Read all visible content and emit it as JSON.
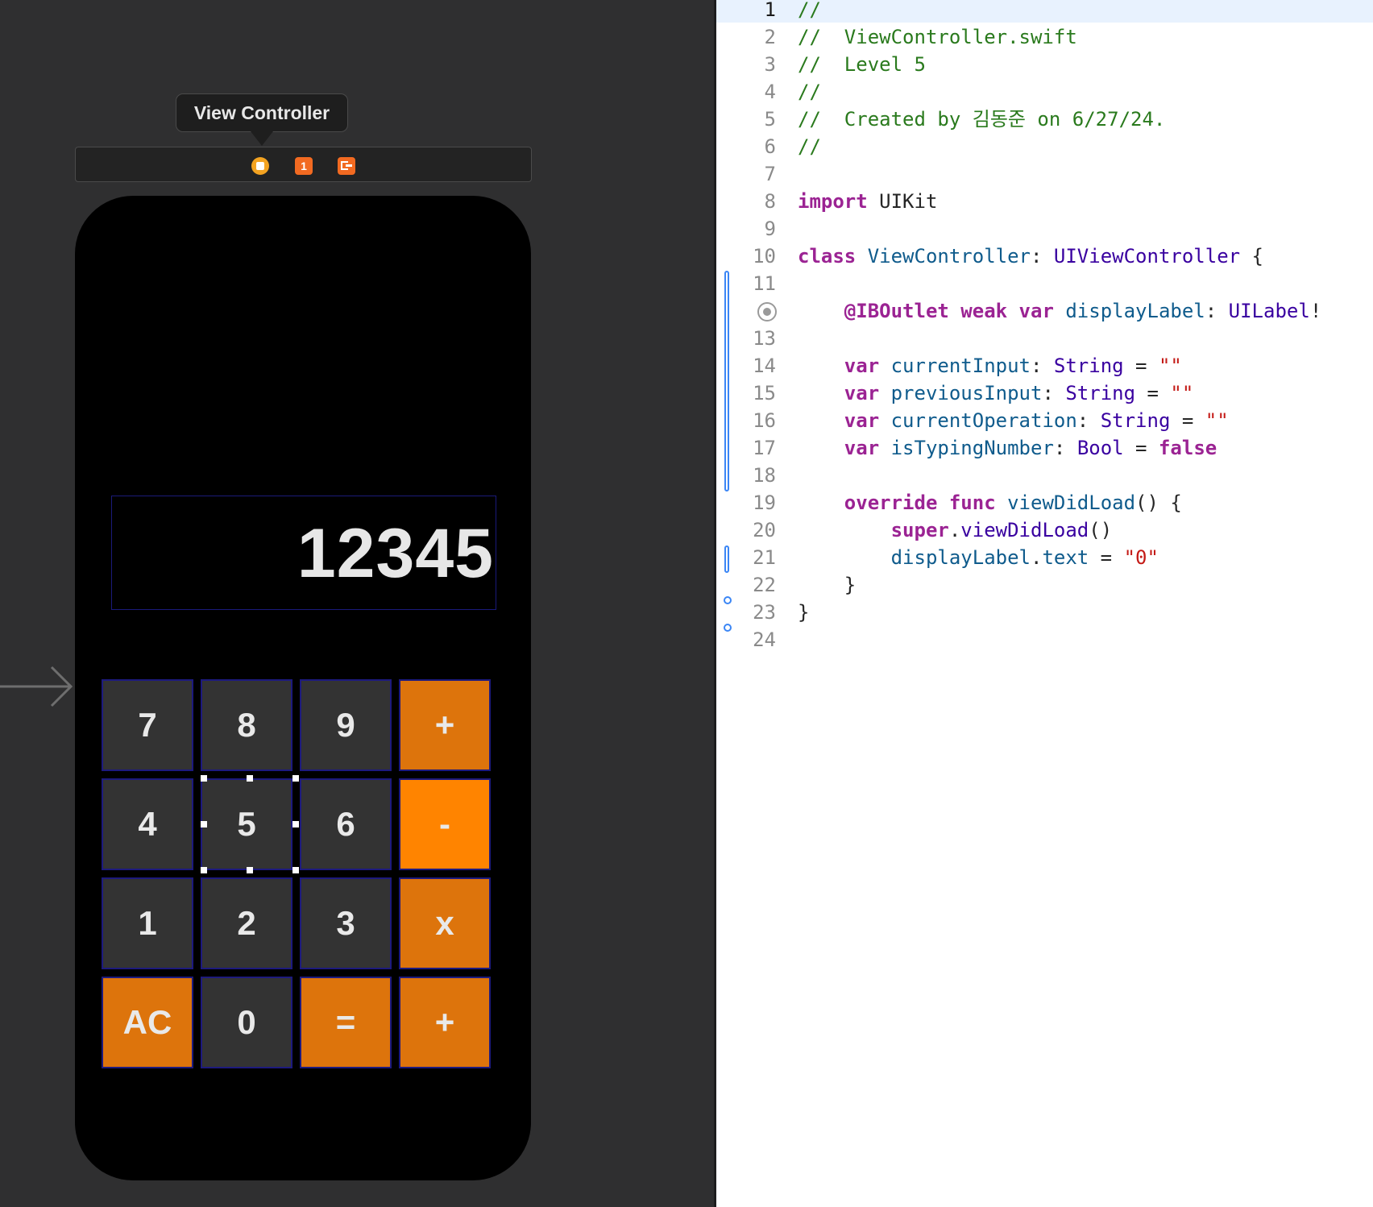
{
  "storyboard": {
    "scene_title": "View Controller",
    "dock": {
      "vc_icon": "view-controller-icon",
      "first_responder_label": "1",
      "exit_icon": "exit-icon"
    },
    "display_text": "12345",
    "keys": [
      "7",
      "8",
      "9",
      "+",
      "4",
      "5",
      "6",
      "-",
      "1",
      "2",
      "3",
      "x",
      "AC",
      "0",
      "=",
      "+"
    ],
    "colors": {
      "op_key": "#dd740c",
      "op_key_highlight": "#ff8400",
      "num_key": "#333333"
    }
  },
  "editor": {
    "current_line": 1,
    "lines": [
      {
        "n": "1",
        "tokens": [
          {
            "c": "c",
            "t": "//"
          }
        ]
      },
      {
        "n": "2",
        "tokens": [
          {
            "c": "c",
            "t": "//  ViewController.swift"
          }
        ]
      },
      {
        "n": "3",
        "tokens": [
          {
            "c": "c",
            "t": "//  Level 5"
          }
        ]
      },
      {
        "n": "4",
        "tokens": [
          {
            "c": "c",
            "t": "//"
          }
        ]
      },
      {
        "n": "5",
        "tokens": [
          {
            "c": "c",
            "t": "//  Created by 김동준 on 6/27/24."
          }
        ]
      },
      {
        "n": "6",
        "tokens": [
          {
            "c": "c",
            "t": "//"
          }
        ]
      },
      {
        "n": "7",
        "tokens": []
      },
      {
        "n": "8",
        "tokens": [
          {
            "c": "k",
            "t": "import"
          },
          {
            "c": "",
            "t": " UIKit"
          }
        ]
      },
      {
        "n": "9",
        "tokens": []
      },
      {
        "n": "10",
        "tokens": [
          {
            "c": "k",
            "t": "class"
          },
          {
            "c": "",
            "t": " "
          },
          {
            "c": "n",
            "t": "ViewController"
          },
          {
            "c": "",
            "t": ": "
          },
          {
            "c": "t",
            "t": "UIViewController"
          },
          {
            "c": "",
            "t": " {"
          }
        ]
      },
      {
        "n": "11",
        "tokens": []
      },
      {
        "n": "",
        "tokens": [
          {
            "c": "",
            "t": "    "
          },
          {
            "c": "k",
            "t": "@IBOutlet"
          },
          {
            "c": "",
            "t": " "
          },
          {
            "c": "k",
            "t": "weak"
          },
          {
            "c": "",
            "t": " "
          },
          {
            "c": "k",
            "t": "var"
          },
          {
            "c": "",
            "t": " "
          },
          {
            "c": "n",
            "t": "displayLabel"
          },
          {
            "c": "",
            "t": ": "
          },
          {
            "c": "t",
            "t": "UILabel"
          },
          {
            "c": "",
            "t": "!"
          }
        ]
      },
      {
        "n": "13",
        "tokens": []
      },
      {
        "n": "14",
        "tokens": [
          {
            "c": "",
            "t": "    "
          },
          {
            "c": "k",
            "t": "var"
          },
          {
            "c": "",
            "t": " "
          },
          {
            "c": "n",
            "t": "currentInput"
          },
          {
            "c": "",
            "t": ": "
          },
          {
            "c": "t",
            "t": "String"
          },
          {
            "c": "",
            "t": " = "
          },
          {
            "c": "s",
            "t": "\"\""
          }
        ]
      },
      {
        "n": "15",
        "tokens": [
          {
            "c": "",
            "t": "    "
          },
          {
            "c": "k",
            "t": "var"
          },
          {
            "c": "",
            "t": " "
          },
          {
            "c": "n",
            "t": "previousInput"
          },
          {
            "c": "",
            "t": ": "
          },
          {
            "c": "t",
            "t": "String"
          },
          {
            "c": "",
            "t": " = "
          },
          {
            "c": "s",
            "t": "\"\""
          }
        ]
      },
      {
        "n": "16",
        "tokens": [
          {
            "c": "",
            "t": "    "
          },
          {
            "c": "k",
            "t": "var"
          },
          {
            "c": "",
            "t": " "
          },
          {
            "c": "n",
            "t": "currentOperation"
          },
          {
            "c": "",
            "t": ": "
          },
          {
            "c": "t",
            "t": "String"
          },
          {
            "c": "",
            "t": " = "
          },
          {
            "c": "s",
            "t": "\"\""
          }
        ]
      },
      {
        "n": "17",
        "tokens": [
          {
            "c": "",
            "t": "    "
          },
          {
            "c": "k",
            "t": "var"
          },
          {
            "c": "",
            "t": " "
          },
          {
            "c": "n",
            "t": "isTypingNumber"
          },
          {
            "c": "",
            "t": ": "
          },
          {
            "c": "t",
            "t": "Bool"
          },
          {
            "c": "",
            "t": " = "
          },
          {
            "c": "k",
            "t": "false"
          }
        ]
      },
      {
        "n": "18",
        "tokens": []
      },
      {
        "n": "19",
        "tokens": [
          {
            "c": "",
            "t": "    "
          },
          {
            "c": "k",
            "t": "override"
          },
          {
            "c": "",
            "t": " "
          },
          {
            "c": "k",
            "t": "func"
          },
          {
            "c": "",
            "t": " "
          },
          {
            "c": "n",
            "t": "viewDidLoad"
          },
          {
            "c": "",
            "t": "() {"
          }
        ]
      },
      {
        "n": "20",
        "tokens": [
          {
            "c": "",
            "t": "        "
          },
          {
            "c": "k",
            "t": "super"
          },
          {
            "c": "",
            "t": "."
          },
          {
            "c": "t",
            "t": "viewDidLoad"
          },
          {
            "c": "",
            "t": "()"
          }
        ]
      },
      {
        "n": "21",
        "tokens": [
          {
            "c": "",
            "t": "        "
          },
          {
            "c": "n",
            "t": "displayLabel"
          },
          {
            "c": "",
            "t": "."
          },
          {
            "c": "n",
            "t": "text"
          },
          {
            "c": "",
            "t": " = "
          },
          {
            "c": "s",
            "t": "\"0\""
          }
        ]
      },
      {
        "n": "22",
        "tokens": [
          {
            "c": "",
            "t": "    }"
          }
        ]
      },
      {
        "n": "23",
        "tokens": [
          {
            "c": "",
            "t": "}"
          }
        ]
      },
      {
        "n": "24",
        "tokens": []
      }
    ]
  }
}
